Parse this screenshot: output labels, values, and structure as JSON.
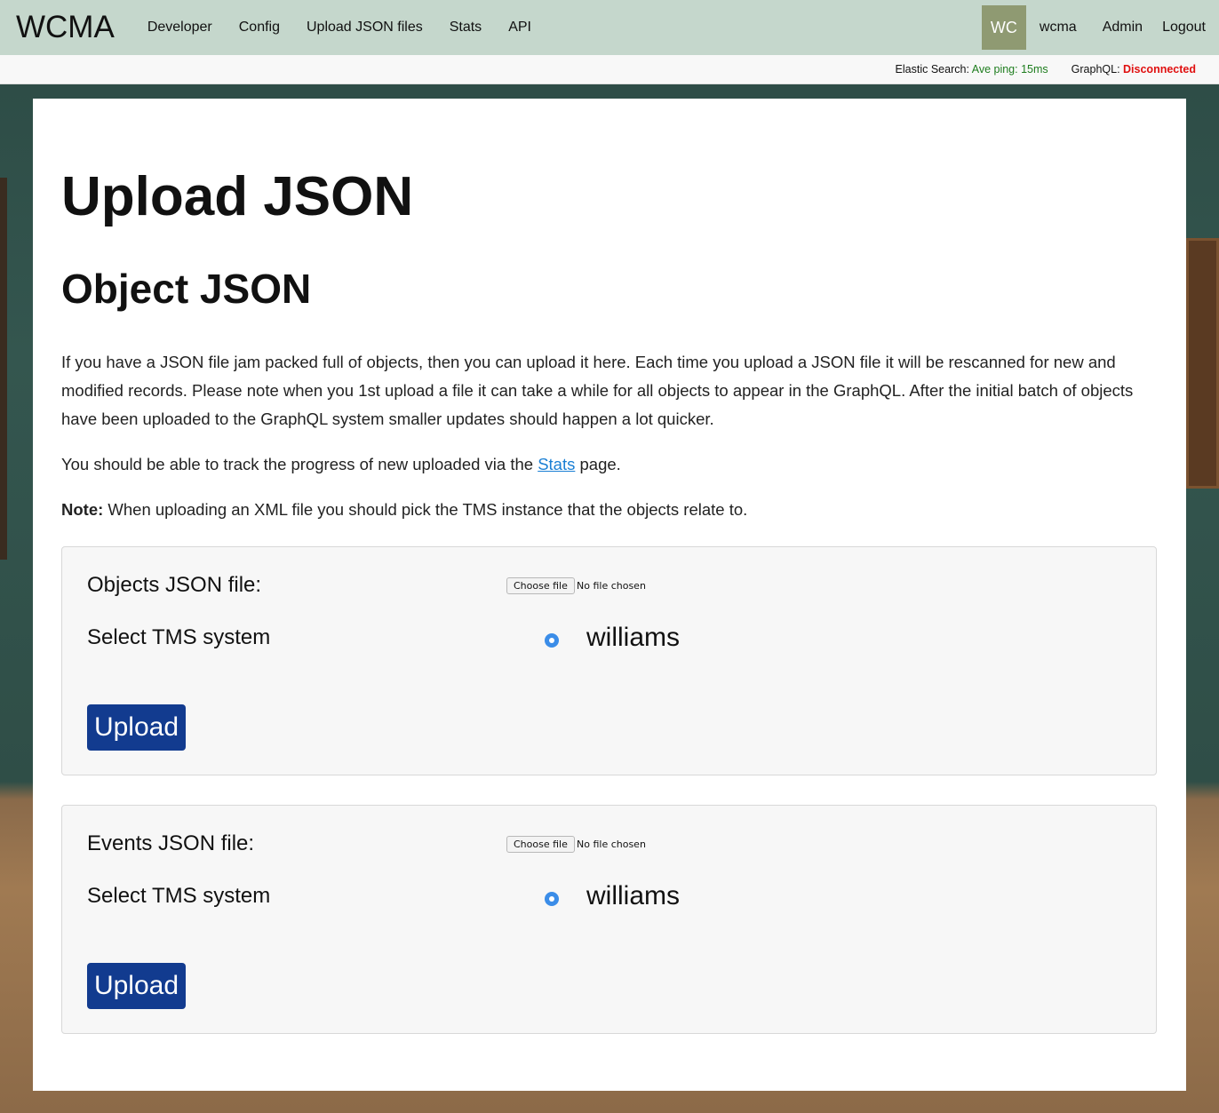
{
  "nav": {
    "brand": "WCMA",
    "links": [
      "Developer",
      "Config",
      "Upload JSON files",
      "Stats",
      "API"
    ],
    "avatar_initials": "WC",
    "user": "wcma",
    "admin": "Admin",
    "logout": "Logout"
  },
  "status": {
    "elastic_label": "Elastic Search:",
    "elastic_value": "Ave ping: 15ms",
    "graphql_label": "GraphQL:",
    "graphql_value": "Disconnected"
  },
  "page": {
    "title": "Upload JSON",
    "subtitle": "Object JSON",
    "intro": "If you have a JSON file jam packed full of objects, then you can upload it here. Each time you upload a JSON file it will be rescanned for new and modified records. Please note when you 1st upload a file it can take a while for all objects to appear in the GraphQL. After the initial batch of objects have been uploaded to the GraphQL system smaller updates should happen a lot quicker.",
    "track_before": "You should be able to track the progress of new uploaded via the ",
    "track_link": "Stats",
    "track_after": " page.",
    "note_label": "Note:",
    "note_text": " When uploading an XML file you should pick the TMS instance that the objects relate to."
  },
  "objects_panel": {
    "file_label": "Objects JSON file:",
    "choose_file": "Choose file",
    "file_status": "No file chosen",
    "tms_label": "Select TMS system",
    "tms_option": "williams",
    "upload": "Upload"
  },
  "events_panel": {
    "file_label": "Events JSON file:",
    "choose_file": "Choose file",
    "file_status": "No file chosen",
    "tms_label": "Select TMS system",
    "tms_option": "williams",
    "upload": "Upload"
  },
  "colors": {
    "nav_bg": "#c5d7cc",
    "avatar_bg": "#8f9a72",
    "button_bg": "#123b8f",
    "status_ok": "#1e7d1e",
    "status_bad": "#e01010",
    "link": "#1a7fd4"
  }
}
